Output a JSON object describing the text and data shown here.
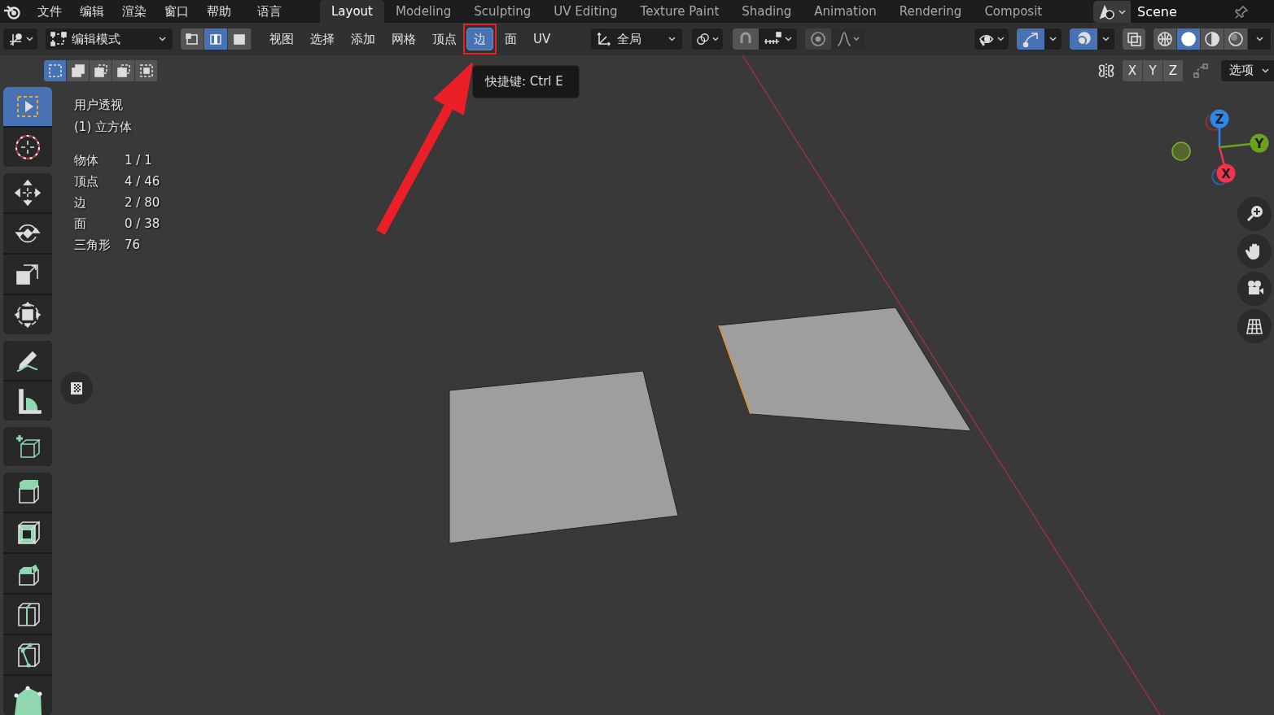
{
  "menu": [
    "文件",
    "编辑",
    "渲染",
    "窗口",
    "帮助",
    "语言"
  ],
  "workspaces": [
    {
      "label": "Layout",
      "selected": true
    },
    {
      "label": "Modeling",
      "selected": false
    },
    {
      "label": "Sculpting",
      "selected": false
    },
    {
      "label": "UV Editing",
      "selected": false
    },
    {
      "label": "Texture Paint",
      "selected": false
    },
    {
      "label": "Shading",
      "selected": false
    },
    {
      "label": "Animation",
      "selected": false
    },
    {
      "label": "Rendering",
      "selected": false
    },
    {
      "label": "Composit",
      "selected": false
    }
  ],
  "scene": "Scene",
  "header": {
    "mode": "编辑模式",
    "select_modes": [
      {
        "kind": "vertex",
        "selected": false
      },
      {
        "kind": "edge",
        "selected": true
      },
      {
        "kind": "face",
        "selected": false
      }
    ],
    "menus": [
      {
        "label": "视图",
        "selected": false,
        "marked": false
      },
      {
        "label": "选择",
        "selected": false,
        "marked": false
      },
      {
        "label": "添加",
        "selected": false,
        "marked": false
      },
      {
        "label": "网格",
        "selected": false,
        "marked": false
      },
      {
        "label": "顶点",
        "selected": false,
        "marked": false
      },
      {
        "label": "边",
        "selected": true,
        "marked": true
      },
      {
        "label": "面",
        "selected": false,
        "marked": false
      },
      {
        "label": "UV",
        "selected": false,
        "marked": false
      }
    ],
    "orientation": "全局",
    "shading": [
      {
        "kind": "wireframe",
        "selected": false
      },
      {
        "kind": "solid",
        "selected": true
      },
      {
        "kind": "material",
        "selected": false
      },
      {
        "kind": "rendered",
        "selected": false
      }
    ]
  },
  "box_modes": [
    {
      "kind": "new",
      "selected": true
    },
    {
      "kind": "extend",
      "selected": false
    },
    {
      "kind": "subtract",
      "selected": false
    },
    {
      "kind": "invert",
      "selected": false
    },
    {
      "kind": "intersect",
      "selected": false
    }
  ],
  "axes": [
    "X",
    "Y",
    "Z"
  ],
  "options": "选项",
  "tooltip": "快捷键: Ctrl E",
  "overlay": {
    "view": "用户透视",
    "object": "(1) 立方体",
    "stats": [
      {
        "label": "物体",
        "value": "1 / 1"
      },
      {
        "label": "顶点",
        "value": "4 / 46"
      },
      {
        "label": "边",
        "value": "2 / 80"
      },
      {
        "label": "面",
        "value": "0 / 38"
      },
      {
        "label": "三角形",
        "value": "76"
      }
    ]
  },
  "tool_groups": [
    [
      {
        "kind": "select-box",
        "selected": true
      },
      {
        "kind": "cursor",
        "selected": false
      }
    ],
    [
      {
        "kind": "move",
        "selected": false
      },
      {
        "kind": "rotate",
        "selected": false
      },
      {
        "kind": "scale",
        "selected": false
      },
      {
        "kind": "transform",
        "selected": false
      }
    ],
    [
      {
        "kind": "annotate",
        "selected": false
      },
      {
        "kind": "measure",
        "selected": false
      }
    ],
    [
      {
        "kind": "add-cube",
        "selected": false
      }
    ],
    [
      {
        "kind": "extrude",
        "selected": false
      },
      {
        "kind": "inset",
        "selected": false
      },
      {
        "kind": "bevel",
        "selected": false
      },
      {
        "kind": "loop-cut",
        "selected": false
      },
      {
        "kind": "knife",
        "selected": false
      },
      {
        "kind": "poly-build",
        "selected": false
      }
    ]
  ],
  "gizmo": [
    {
      "label": "Z",
      "color": "#2f86e8"
    },
    {
      "label": "Y",
      "color": "#6ca11e"
    },
    {
      "label": "X",
      "color": "#f2344f"
    }
  ]
}
